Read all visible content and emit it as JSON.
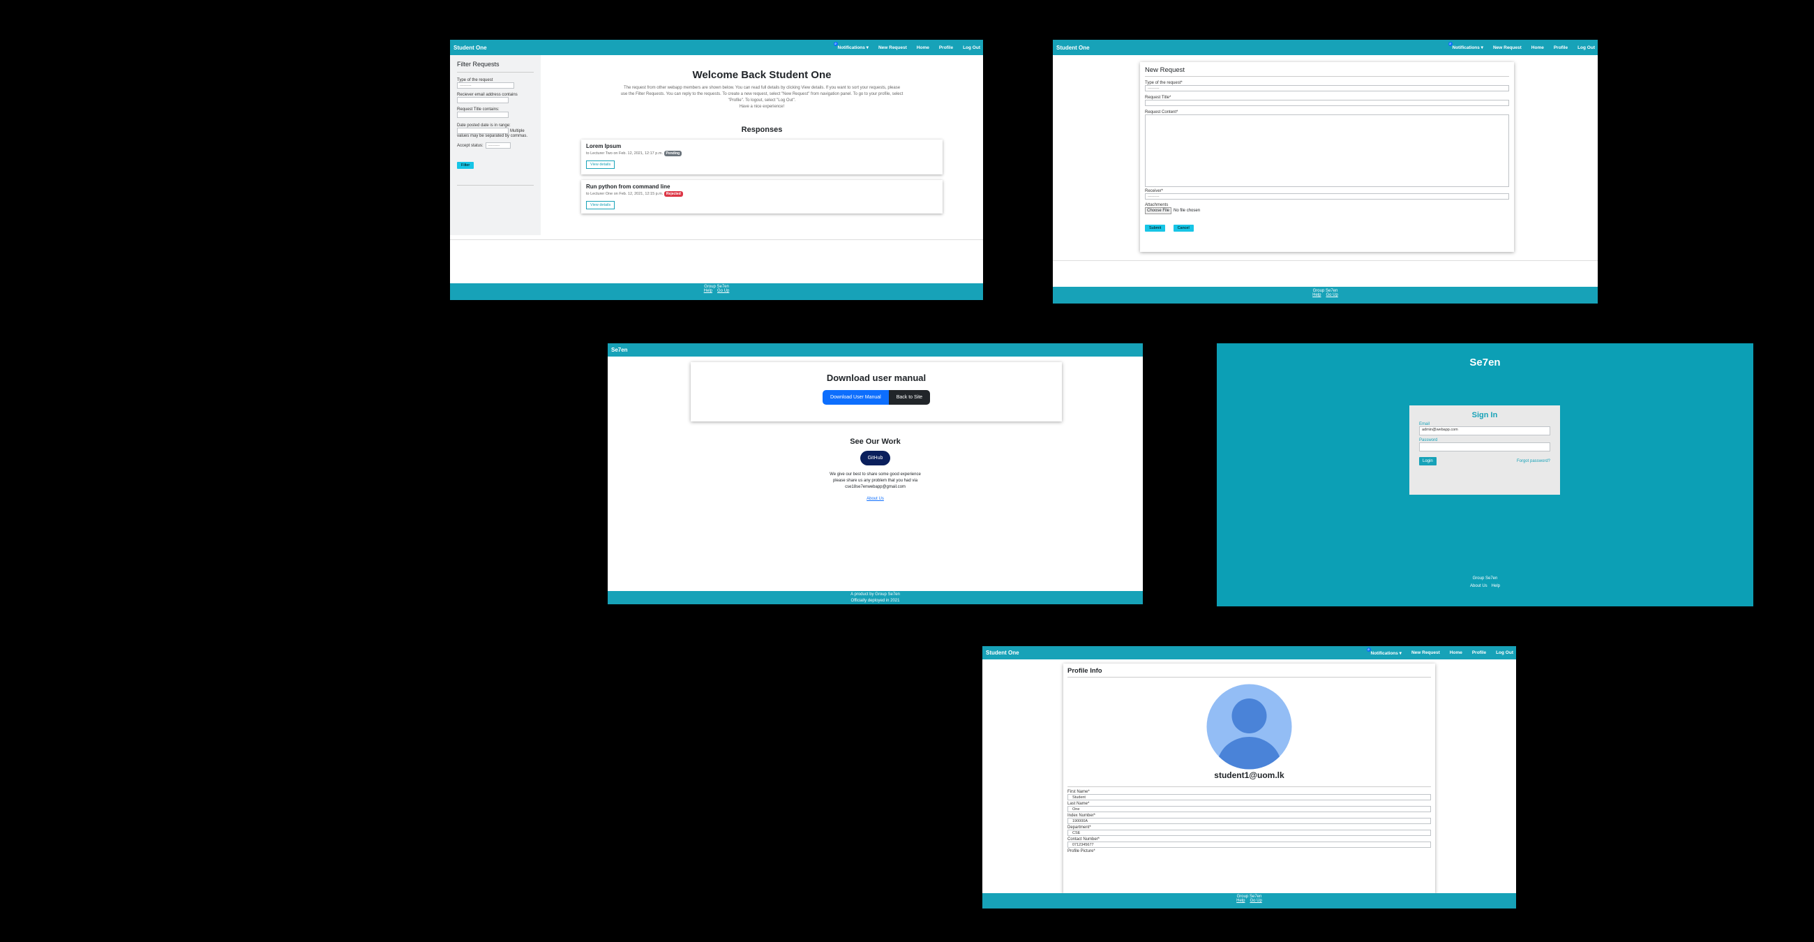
{
  "nav": {
    "brand": "Student One",
    "notifications": "Notifications ▾",
    "new_request": "New Request",
    "home": "Home",
    "profile": "Profile",
    "logout": "Log Out",
    "badge": "0"
  },
  "footer": {
    "group": "Group Se7en",
    "help": "Help",
    "go_up": "Go Up"
  },
  "dashboard": {
    "filter": {
      "title": "Filter Requests",
      "type_label": "Type of the request",
      "type_value": "---------",
      "receiver_label": "Reciever email address contains",
      "title_label": "Request Title contains:",
      "date_label": "Date posted date is in range:",
      "multiple": "Multiple",
      "separated": "values may be separated by commas.",
      "accept_label": "Accept status:",
      "accept_value": "---------",
      "button": "Filter"
    },
    "welcome": "Welcome Back Student One",
    "intro_lines": [
      "The request from other webapp members are shown below. You can read full details by clicking View details. If you want to sort your requests, please",
      "use the Filter Requests. You can reply to the requests. To create a new request, select \"New Request\" from navigation panel. To go to your profile, select",
      "\"Profile\". To logout, select \"Log Out\".",
      "Have a nice experience!"
    ],
    "responses_title": "Responses",
    "responses": [
      {
        "title": "Lorem Ipsum",
        "meta": "to Lecturer Two on Feb. 12, 2021, 12:17 p.m.",
        "badge": "Pending",
        "badge_color": "#6c757d",
        "button": "View details"
      },
      {
        "title": "Run python from command line",
        "meta": "to Lecturer One on Feb. 12, 2021, 12:15 p.m.",
        "badge": "Rejected",
        "badge_color": "#dc3545",
        "button": "View details"
      }
    ]
  },
  "new_request": {
    "title": "New Request",
    "type_label": "Type of the request*",
    "type_value": "---------",
    "req_title_label": "Request Title*",
    "content_label": "Request Content*",
    "receiver_label": "Receiver*",
    "receiver_value": "---------",
    "attachments_label": "Attachments",
    "choose_file": "Choose File",
    "no_file": "No file chosen",
    "submit": "Submit",
    "cancel": "Cancel"
  },
  "download": {
    "brand": "Se7en",
    "title": "Download user manual",
    "download_button": "Download User Manual",
    "back_button": "Back to Site",
    "see_work": "See Our Work",
    "github": "GitHub",
    "text_lines": [
      "We give our best to share some good experience",
      "please share us any problem that you had via",
      "cse18se7enwebapp@gmail.com"
    ],
    "about": "About Us",
    "footer_line1": "A product by Group Se7en",
    "footer_line2": "Officially deployed in 2021"
  },
  "signin": {
    "brand": "Se7en",
    "title": "Sign In",
    "email_label": "Email",
    "email_value": "admin@webapp.com",
    "password_label": "Password",
    "login": "Login",
    "forgot": "Forgot password?",
    "footer_group": "Group Se7en",
    "about": "About Us",
    "help": "Help"
  },
  "profile": {
    "title": "Profile Info",
    "email": "student1@uom.lk",
    "fields": [
      {
        "label": "First Name*",
        "value": "Student"
      },
      {
        "label": "Last Name*",
        "value": "One"
      },
      {
        "label": "Index Number*",
        "value": "190000A"
      },
      {
        "label": "Department*",
        "value": "CSE"
      },
      {
        "label": "Contact Number*",
        "value": "0712345677"
      }
    ],
    "picture_label": "Profile Picture*"
  },
  "colors": {
    "teal": "#17a2b8",
    "cyan_button": "#17c5e6",
    "blue": "#0d6efd",
    "navy": "#0a1f5c",
    "sign_in_bg": "#e9e9e9"
  }
}
